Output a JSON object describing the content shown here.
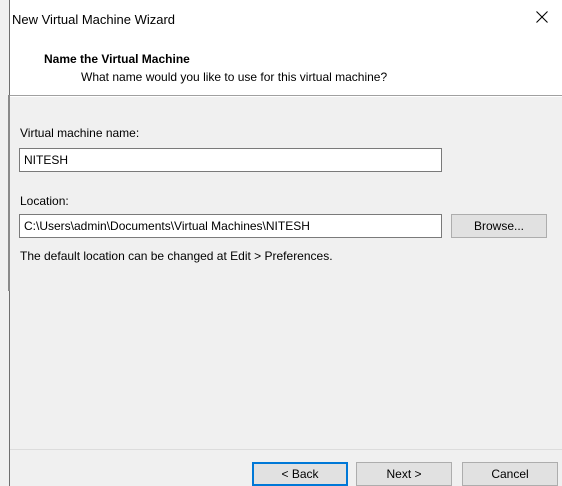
{
  "window": {
    "title": "New Virtual Machine Wizard",
    "close_icon": "close-icon"
  },
  "header": {
    "title": "Name the Virtual Machine",
    "subtitle": "What name would you like to use for this virtual machine?"
  },
  "form": {
    "name_label": "Virtual machine name:",
    "name_value": "NITESH",
    "location_label": "Location:",
    "location_value": "C:\\Users\\admin\\Documents\\Virtual Machines\\NITESH",
    "browse_label": "Browse...",
    "hint": "The default location can be changed at Edit > Preferences."
  },
  "footer": {
    "back_label": "< Back",
    "next_label": "Next >",
    "cancel_label": "Cancel"
  },
  "colors": {
    "default_button_border": "#0078d7",
    "dialog_background": "#f0f0f0",
    "header_background": "#ffffff"
  }
}
